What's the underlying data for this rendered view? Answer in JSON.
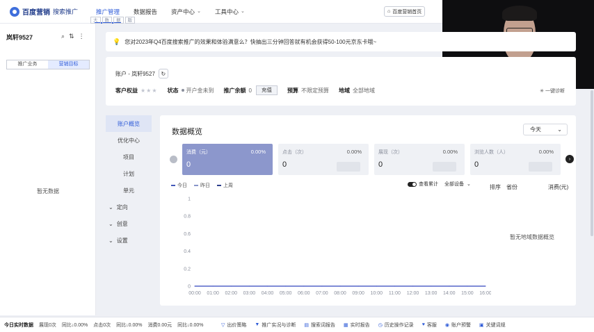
{
  "header": {
    "logo_text": "百度营销",
    "product": "搜索推广",
    "nav": [
      {
        "label": "推广管理",
        "active": true,
        "dropdown": false
      },
      {
        "label": "数据报告",
        "active": false,
        "dropdown": false
      },
      {
        "label": "资产中心",
        "active": false,
        "dropdown": true
      },
      {
        "label": "工具中心",
        "active": false,
        "dropdown": true
      }
    ],
    "home_button": "百度营销首页",
    "badges": [
      "大",
      "数",
      "据",
      "版"
    ]
  },
  "left_panel": {
    "account_name": "岚轩9527",
    "tabs": [
      {
        "label": "推广业务",
        "selected": false
      },
      {
        "label": "营销目标",
        "selected": true
      }
    ],
    "empty_text": "暂无数据"
  },
  "notice": {
    "text": "您对2023年Q4百度搜索推广的效果和体验满意么？快抽出三分钟回答就有机会获得50-100元京东卡哦~"
  },
  "account": {
    "label": "账户 - 岚轩9527",
    "rights_label": "客户权益",
    "status_label": "状态",
    "status_value": "开户金未到",
    "balance_label": "推广余额",
    "balance_value": "0",
    "recharge_button": "充值",
    "budget_label": "预算",
    "budget_value": "不限定预算",
    "region_label": "地域",
    "region_value": "全部地域",
    "onekey_button": "一键诊断"
  },
  "subnav": [
    {
      "label": "账户概览",
      "active": true,
      "expandable": false
    },
    {
      "label": "优化中心",
      "active": false,
      "expandable": false
    },
    {
      "label": "项目",
      "active": false,
      "expandable": false
    },
    {
      "label": "计划",
      "active": false,
      "expandable": false
    },
    {
      "label": "单元",
      "active": false,
      "expandable": false
    },
    {
      "label": "定向",
      "active": false,
      "expandable": true
    },
    {
      "label": "创意",
      "active": false,
      "expandable": true
    },
    {
      "label": "设置",
      "active": false,
      "expandable": true
    }
  ],
  "overview": {
    "title": "数据概览",
    "range": "今天",
    "kpis": [
      {
        "name": "消费（元）",
        "pct": "0.00%",
        "value": "0",
        "primary": true
      },
      {
        "name": "点击（次）",
        "pct": "0.00%",
        "value": "0",
        "primary": false
      },
      {
        "name": "展现（次）",
        "pct": "0.00%",
        "value": "0",
        "primary": false
      },
      {
        "name": "浏览人数（人）",
        "pct": "0.00%",
        "value": "0",
        "primary": false
      }
    ],
    "legend": [
      "今日",
      "昨日",
      "上周"
    ],
    "compare_toggle": "查看累计",
    "device_select": "全部设备",
    "rank_headers": [
      "排序",
      "省份",
      "消费(元)"
    ],
    "rank_empty": "暂无地域数据概览"
  },
  "chart_data": {
    "type": "line",
    "x": [
      "00:00",
      "01:00",
      "02:00",
      "03:00",
      "04:00",
      "05:00",
      "06:00",
      "07:00",
      "08:00",
      "09:00",
      "10:00",
      "11:00",
      "12:00",
      "13:00",
      "14:00",
      "15:00",
      "16:00"
    ],
    "series": [
      {
        "name": "今日",
        "values": [
          0,
          0,
          0,
          0,
          0,
          0,
          0,
          0,
          0,
          0,
          0,
          0,
          0,
          0,
          0,
          0,
          0
        ]
      }
    ],
    "yticks": [
      "0",
      "0.2",
      "0.4",
      "0.6",
      "0.8",
      "1"
    ],
    "ylim": [
      0,
      1
    ],
    "grid": false,
    "line_color": "#5363c9"
  },
  "bottom": {
    "stats_title": "今日实时数据",
    "stats": [
      "展现0次",
      "同比↓0.00%",
      "点击0次",
      "同比↓0.00%",
      "消费0.00元",
      "同比↓0.00%"
    ],
    "tools": [
      "出价策略",
      "推广实况与诊断",
      "搜索词报告",
      "实时报告",
      "历史操作记录",
      "客服",
      "账户预警",
      "关键词规"
    ]
  }
}
